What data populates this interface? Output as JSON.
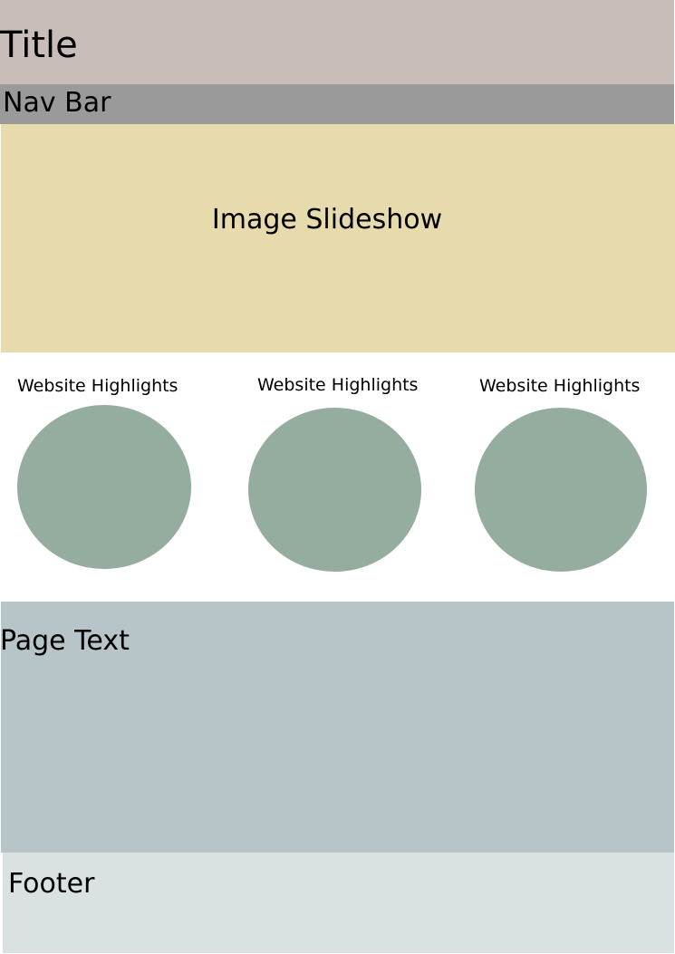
{
  "title": {
    "label": "Title"
  },
  "nav": {
    "label": "Nav Bar"
  },
  "slideshow": {
    "label": "Image Slideshow"
  },
  "highlights": [
    {
      "label": "Website Highlights"
    },
    {
      "label": "Website Highlights"
    },
    {
      "label": "Website Highlights"
    }
  ],
  "page_text": {
    "label": "Page Text"
  },
  "footer": {
    "label": "Footer"
  },
  "colors": {
    "title_bg": "#c8bdb8",
    "nav_bg": "#9a9a9a",
    "slideshow_bg": "#e7dbad",
    "highlight_circle": "#95ad9f",
    "page_text_bg": "#b7c4c8",
    "footer_bg": "#d9e1e2"
  }
}
